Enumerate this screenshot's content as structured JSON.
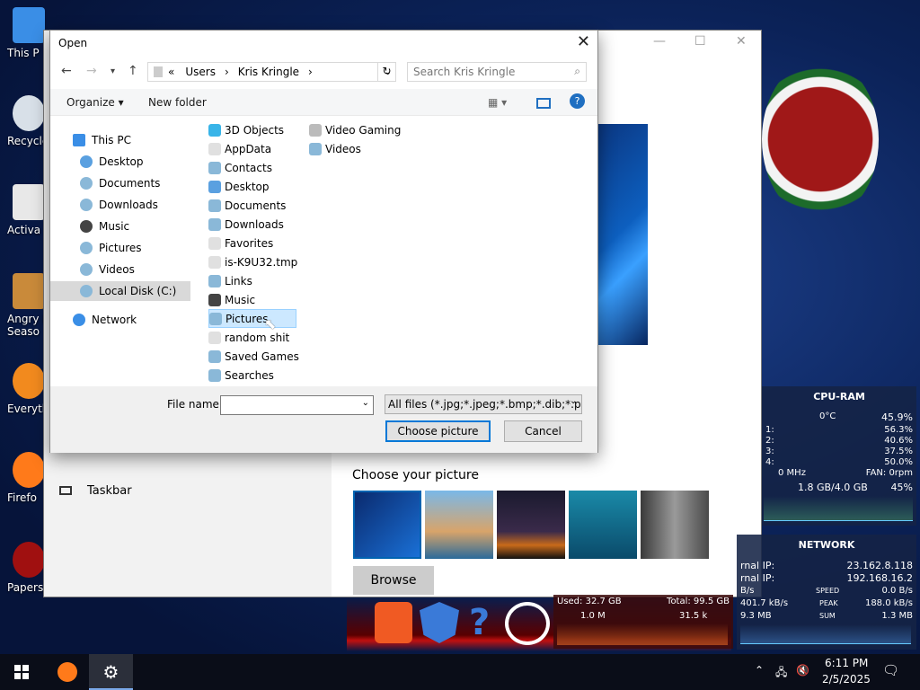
{
  "desktop": {
    "icons": [
      {
        "label": "This P",
        "color": "#3a8ee6"
      },
      {
        "label": "Recycle",
        "color": "#d8e0e8"
      },
      {
        "label": "Activa",
        "color": "#e8e8e8"
      },
      {
        "label": "Angry B\nSeaso",
        "color": "#c98a3a"
      },
      {
        "label": "Everyth",
        "color": "#f28a1e"
      },
      {
        "label": "Firefo",
        "color": "#ff7a1a"
      },
      {
        "label": "Papers, P",
        "color": "#a01010"
      }
    ]
  },
  "settings": {
    "sidebar_item": "Taskbar",
    "choose_picture": "Choose your picture",
    "browse": "Browse"
  },
  "dialog": {
    "title": "Open",
    "address": {
      "sep": "«",
      "path1": "Users",
      "path2": "Kris Kringle"
    },
    "search_placeholder": "Search Kris Kringle",
    "toolbar": {
      "organize": "Organize ▾",
      "new_folder": "New folder"
    },
    "nav": {
      "this_pc": "This PC",
      "items": [
        "Desktop",
        "Documents",
        "Downloads",
        "Music",
        "Pictures",
        "Videos",
        "Local Disk (C:)"
      ],
      "network": "Network"
    },
    "files_col1": [
      "3D Objects",
      "AppData",
      "Contacts",
      "Desktop",
      "Documents",
      "Downloads",
      "Favorites",
      "is-K9U32.tmp",
      "Links",
      "Music",
      "Pictures",
      "random shit",
      "Saved Games",
      "Searches"
    ],
    "files_col2": [
      "Video Gaming",
      "Videos"
    ],
    "file_name_label": "File name:",
    "file_type": "All files (*.jpg;*.jpeg;*.bmp;*.dib;*.png",
    "choose_button": "Choose picture",
    "cancel_button": "Cancel"
  },
  "cpu_widget": {
    "title": "CPU-RAM",
    "temp": "0°C",
    "total": "45.9%",
    "cores": [
      {
        "label": "1:",
        "val": "56.3%"
      },
      {
        "label": "2:",
        "val": "40.6%"
      },
      {
        "label": "3:",
        "val": "37.5%"
      },
      {
        "label": "4:",
        "val": "50.0%"
      }
    ],
    "mhz": "0 MHz",
    "fan": "FAN: 0rpm",
    "ram": "1.8 GB/4.0 GB",
    "ram_pct": "45%"
  },
  "net_widget": {
    "title": "NETWORK",
    "ext_label": "rnal IP:",
    "ext_ip": "23.162.8.118",
    "int_label": "rnal IP:",
    "int_ip": "192.168.16.2",
    "speed_l": "B/s",
    "speed": "SPEED",
    "speed_v": "0.0 B/s",
    "peak_l": "401.7 kB/s",
    "peak": "PEAK",
    "peak_v": "188.0 kB/s",
    "sum_l": "9.3 MB",
    "sum": "SUM",
    "sum_v": "1.3 MB"
  },
  "disk_widget": {
    "used": "Used: 32.7 GB",
    "total": "Total: 99.5 GB",
    "r": "1.0 M",
    "w": "31.5 k"
  },
  "taskbar": {
    "time": "6:11 PM",
    "date": "2/5/2025"
  }
}
